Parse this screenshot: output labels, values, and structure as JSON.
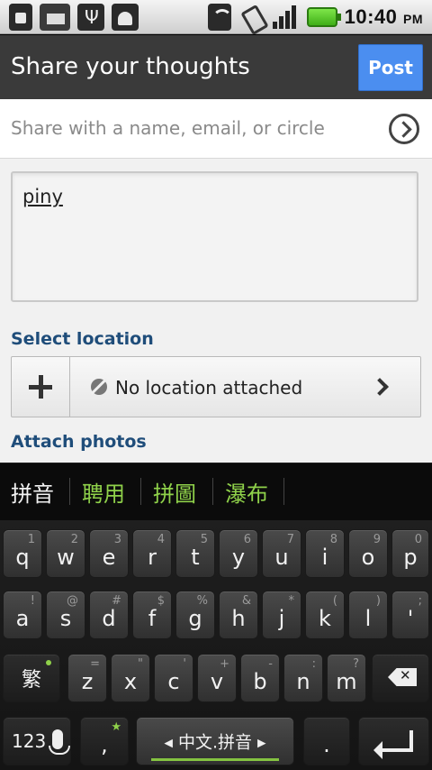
{
  "status_bar": {
    "time": "10:40",
    "ampm": "PM",
    "icons": [
      "lock-icon",
      "mail-icon",
      "usb-icon",
      "android-debug-icon",
      "wifi-icon",
      "vibrate-icon",
      "signal-icon",
      "battery-icon"
    ]
  },
  "header": {
    "title": "Share your thoughts",
    "post_label": "Post"
  },
  "share": {
    "placeholder": "Share with a name, email, or circle"
  },
  "post_text": "piny",
  "location": {
    "section_label": "Select location",
    "value": "No location attached"
  },
  "photos": {
    "section_label": "Attach photos"
  },
  "candidates": [
    "拼音",
    "聘用",
    "拼圖",
    "瀑布"
  ],
  "keyboard": {
    "row1": [
      {
        "k": "q",
        "h": "1"
      },
      {
        "k": "w",
        "h": "2"
      },
      {
        "k": "e",
        "h": "3"
      },
      {
        "k": "r",
        "h": "4"
      },
      {
        "k": "t",
        "h": "5"
      },
      {
        "k": "y",
        "h": "6"
      },
      {
        "k": "u",
        "h": "7"
      },
      {
        "k": "i",
        "h": "8"
      },
      {
        "k": "o",
        "h": "9"
      },
      {
        "k": "p",
        "h": "0"
      }
    ],
    "row2": [
      {
        "k": "a",
        "h": "!"
      },
      {
        "k": "s",
        "h": "@"
      },
      {
        "k": "d",
        "h": "#"
      },
      {
        "k": "f",
        "h": "$"
      },
      {
        "k": "g",
        "h": "%"
      },
      {
        "k": "h",
        "h": "&"
      },
      {
        "k": "j",
        "h": "*"
      },
      {
        "k": "k",
        "h": "("
      },
      {
        "k": "l",
        "h": ")"
      },
      {
        "k": "'",
        "h": ";"
      }
    ],
    "row3": [
      {
        "k": "z",
        "h": "="
      },
      {
        "k": "x",
        "h": "\""
      },
      {
        "k": "c",
        "h": "'"
      },
      {
        "k": "v",
        "h": "+"
      },
      {
        "k": "b",
        "h": "-"
      },
      {
        "k": "n",
        "h": ":"
      },
      {
        "k": "m",
        "h": "?"
      }
    ],
    "trad_key": "繁",
    "num_key": "123",
    "comma_key": ",",
    "comma_hint": "★",
    "space_label": "中文.拼音",
    "period_key": "."
  }
}
